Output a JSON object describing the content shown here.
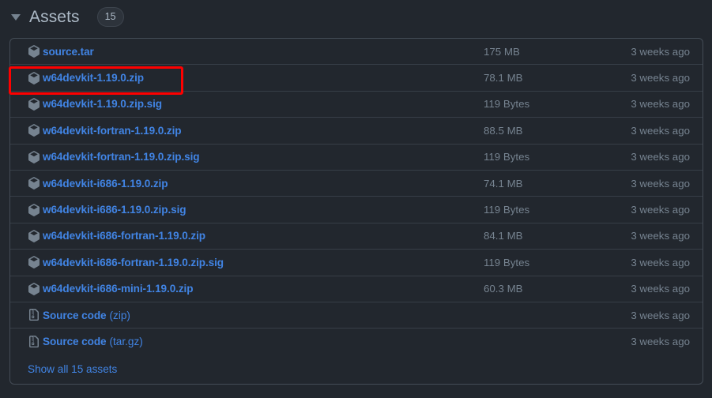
{
  "header": {
    "title": "Assets",
    "count": "15",
    "disclosure_icon": "triangle-down-icon",
    "expanded": true
  },
  "colors": {
    "page_background": "#22272e",
    "link": "#4184e4",
    "muted_text": "#768390",
    "title_text": "#adbac7",
    "row_border": "#373e47",
    "box_border": "#444c56",
    "badge_background": "#2d333b",
    "highlight_outline": "#fe0000"
  },
  "assets": [
    {
      "name": "source.tar",
      "suffix": "",
      "size": "175 MB",
      "date": "3 weeks ago",
      "icon": "package-icon",
      "highlighted": false
    },
    {
      "name": "w64devkit-1.19.0.zip",
      "suffix": "",
      "size": "78.1 MB",
      "date": "3 weeks ago",
      "icon": "package-icon",
      "highlighted": true
    },
    {
      "name": "w64devkit-1.19.0.zip.sig",
      "suffix": "",
      "size": "119 Bytes",
      "date": "3 weeks ago",
      "icon": "package-icon",
      "highlighted": false
    },
    {
      "name": "w64devkit-fortran-1.19.0.zip",
      "suffix": "",
      "size": "88.5 MB",
      "date": "3 weeks ago",
      "icon": "package-icon",
      "highlighted": false
    },
    {
      "name": "w64devkit-fortran-1.19.0.zip.sig",
      "suffix": "",
      "size": "119 Bytes",
      "date": "3 weeks ago",
      "icon": "package-icon",
      "highlighted": false
    },
    {
      "name": "w64devkit-i686-1.19.0.zip",
      "suffix": "",
      "size": "74.1 MB",
      "date": "3 weeks ago",
      "icon": "package-icon",
      "highlighted": false
    },
    {
      "name": "w64devkit-i686-1.19.0.zip.sig",
      "suffix": "",
      "size": "119 Bytes",
      "date": "3 weeks ago",
      "icon": "package-icon",
      "highlighted": false
    },
    {
      "name": "w64devkit-i686-fortran-1.19.0.zip",
      "suffix": "",
      "size": "84.1 MB",
      "date": "3 weeks ago",
      "icon": "package-icon",
      "highlighted": false
    },
    {
      "name": "w64devkit-i686-fortran-1.19.0.zip.sig",
      "suffix": "",
      "size": "119 Bytes",
      "date": "3 weeks ago",
      "icon": "package-icon",
      "highlighted": false
    },
    {
      "name": "w64devkit-i686-mini-1.19.0.zip",
      "suffix": "",
      "size": "60.3 MB",
      "date": "3 weeks ago",
      "icon": "package-icon",
      "highlighted": false
    },
    {
      "name": "Source code",
      "suffix": "(zip)",
      "size": "",
      "date": "3 weeks ago",
      "icon": "file-zip-icon",
      "highlighted": false
    },
    {
      "name": "Source code",
      "suffix": "(tar.gz)",
      "size": "",
      "date": "3 weeks ago",
      "icon": "file-zip-icon",
      "highlighted": false
    }
  ],
  "footer": {
    "show_all_label": "Show all 15 assets"
  }
}
